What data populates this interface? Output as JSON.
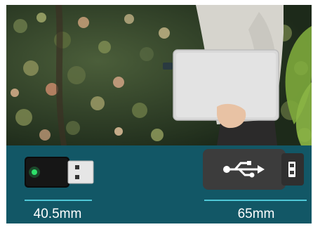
{
  "colors": {
    "panel_background": "#125766",
    "accent_line": "#4fc7d6",
    "label_text": "#ffffff"
  },
  "photo": {
    "subject": "person-holding-laptop-outdoors"
  },
  "products": [
    {
      "icon": "nano-usb-adapter-icon",
      "size_label": "40.5mm"
    },
    {
      "icon": "standard-usb-adapter-icon",
      "size_label": "65mm"
    }
  ]
}
